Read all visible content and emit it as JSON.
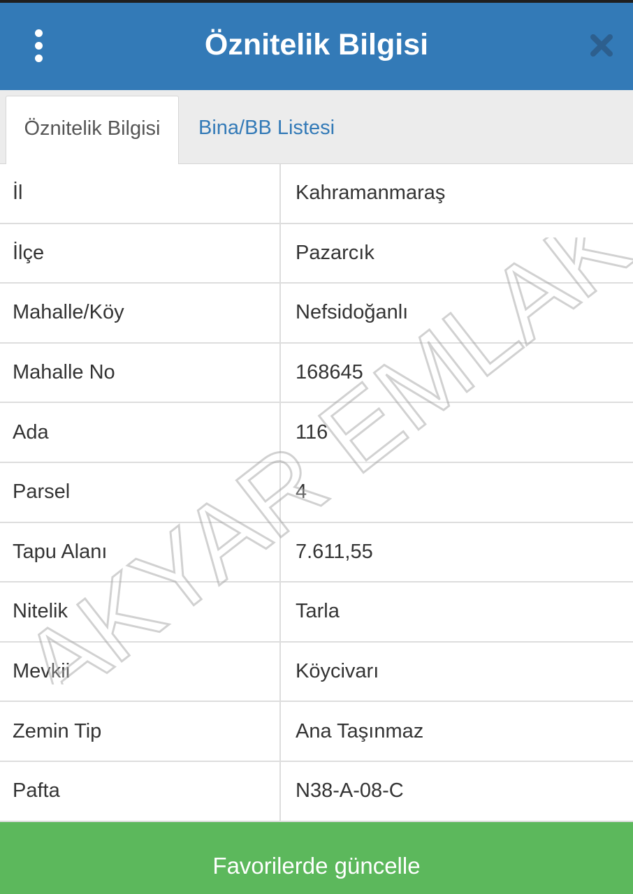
{
  "header": {
    "title": "Öznitelik Bilgisi",
    "menu_icon": "more-vert-icon",
    "close_icon": "close-icon",
    "color": "#337ab7"
  },
  "tabs": [
    {
      "label": "Öznitelik Bilgisi",
      "active": true
    },
    {
      "label": "Bina/BB Listesi",
      "active": false
    }
  ],
  "attributes": [
    {
      "label": "İl",
      "value": "Kahramanmaraş"
    },
    {
      "label": "İlçe",
      "value": "Pazarcık"
    },
    {
      "label": "Mahalle/Köy",
      "value": "Nefsidoğanlı"
    },
    {
      "label": "Mahalle No",
      "value": "168645"
    },
    {
      "label": "Ada",
      "value": "116"
    },
    {
      "label": "Parsel",
      "value": "4"
    },
    {
      "label": "Tapu Alanı",
      "value": "7.611,55"
    },
    {
      "label": "Nitelik",
      "value": "Tarla"
    },
    {
      "label": "Mevkii",
      "value": "Köycivarı"
    },
    {
      "label": "Zemin Tip",
      "value": "Ana Taşınmaz"
    },
    {
      "label": "Pafta",
      "value": "N38-A-08-C"
    }
  ],
  "watermark": {
    "text": "AKYAR EMLAK"
  },
  "footer": {
    "button_label": "Favorilerde güncelle",
    "color": "#5cb85c"
  }
}
